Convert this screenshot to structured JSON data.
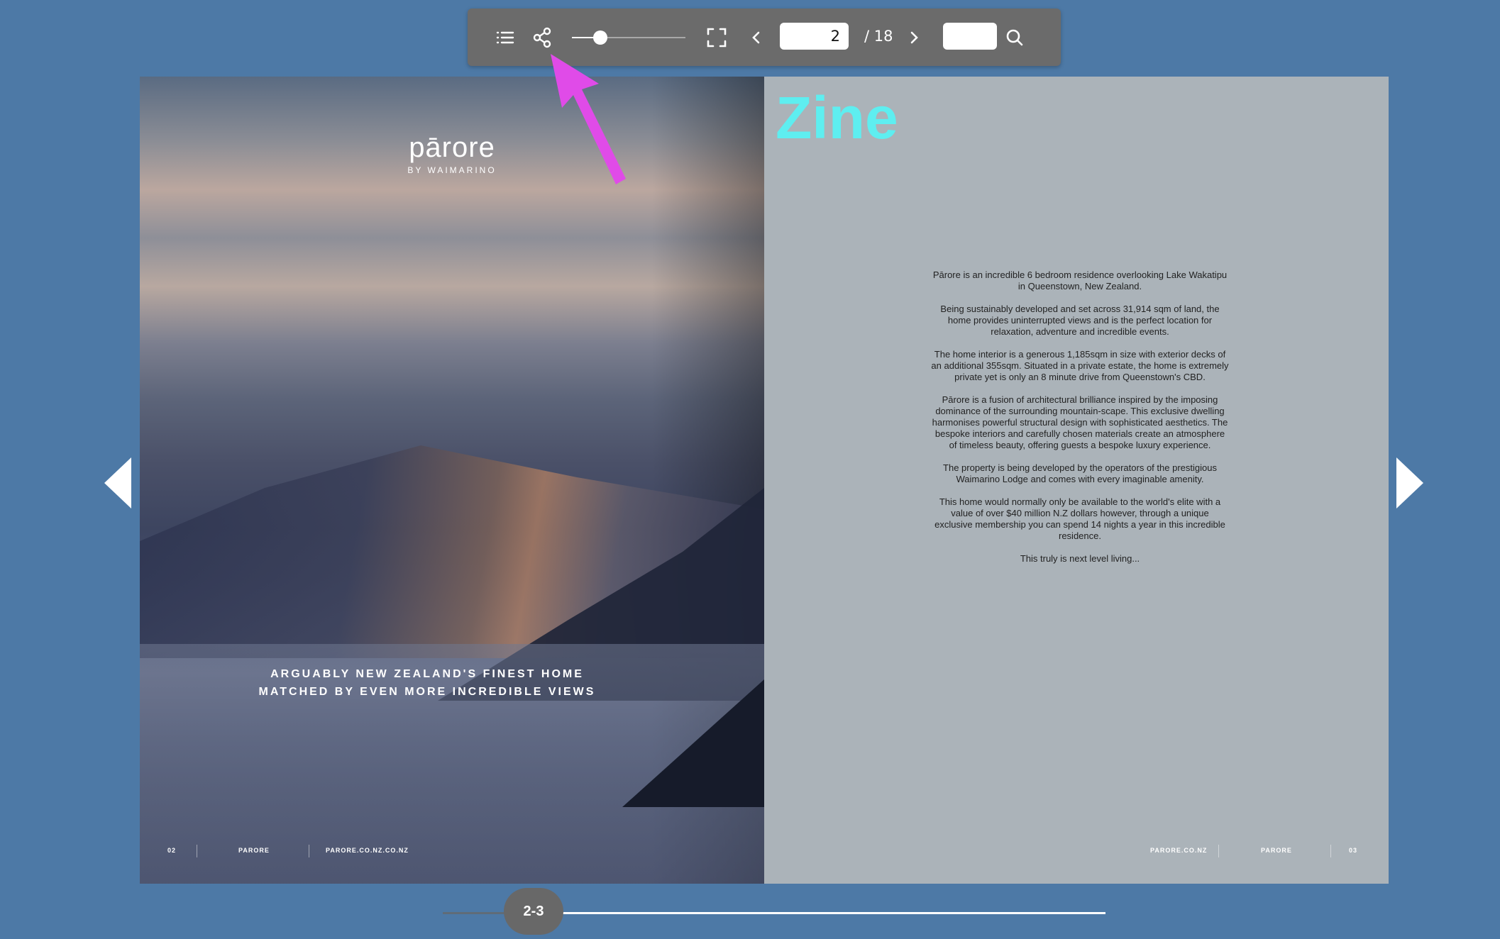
{
  "toolbar": {
    "icons": [
      "table-of-contents-icon",
      "share-icon",
      "fullscreen-icon",
      "chevron-left-icon",
      "chevron-right-icon",
      "search-icon"
    ],
    "zoom_level": 0.25,
    "current_page": "2",
    "total_pages": "/ 18",
    "search_value": ""
  },
  "left_page": {
    "logo_main": "pārore",
    "logo_sub": "BY WAIMARINO",
    "tagline_line1": "ARGUABLY NEW ZEALAND'S FINEST HOME",
    "tagline_line2": "MATCHED BY EVEN MORE INCREDIBLE VIEWS",
    "footer": {
      "page_number": "02",
      "brand": "PARORE",
      "website": "PARORE.CO.NZ.CO.NZ"
    }
  },
  "right_page": {
    "title": "Zine",
    "paragraphs": [
      "Pārore is an incredible 6 bedroom residence overlooking Lake Wakatipu in Queenstown, New Zealand.",
      "Being sustainably developed and set across 31,914 sqm of land, the home provides uninterrupted views and is the perfect location for relaxation, adventure and incredible events.",
      "The home interior is a generous 1,185sqm in size with exterior decks of an additional 355sqm. Situated in a private estate, the home is extremely private yet is only an 8 minute drive from Queenstown's CBD.",
      "Pārore is a fusion of architectural brilliance inspired by the imposing dominance of the surrounding mountain-scape. This exclusive dwelling harmonises powerful structural design with sophisticated aesthetics. The bespoke interiors and carefully chosen materials create an atmosphere of timeless beauty, offering guests a bespoke luxury experience.",
      "The property is being developed by the operators of the prestigious Waimarino Lodge and comes with every imaginable amenity.",
      "This home would normally only be available to the world's elite with a value of over $40 million N.Z dollars however, through a unique exclusive membership you can spend 14 nights a year in this incredible residence.",
      "This truly is next level living..."
    ],
    "footer": {
      "website": "PARORE.CO.NZ",
      "brand": "PARORE",
      "page_number": "03"
    }
  },
  "page_slider": {
    "label": "2-3",
    "position": 0.1
  },
  "colors": {
    "background": "#4d79a6",
    "toolbar": "#6b6b6b",
    "right_page": "#abb3b9",
    "title_accent": "#5eeef0",
    "annotation_arrow": "#e04be8"
  }
}
